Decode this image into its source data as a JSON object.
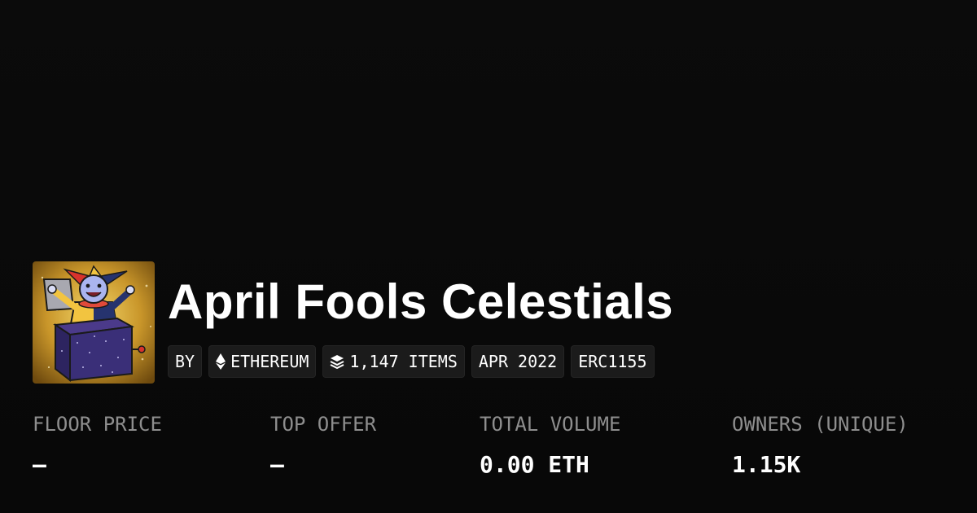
{
  "collection": {
    "title": "April Fools Celestials",
    "image": "jack-in-the-box-jester-avatar"
  },
  "tags": {
    "by": "BY",
    "chain": "ETHEREUM",
    "chain_icon": "ethereum-icon",
    "items": "1,147 ITEMS",
    "items_icon": "layers-icon",
    "date": "APR 2022",
    "standard": "ERC1155"
  },
  "stats": {
    "floor_price": {
      "label": "FLOOR PRICE",
      "value": "–"
    },
    "top_offer": {
      "label": "TOP OFFER",
      "value": "–"
    },
    "total_volume": {
      "label": "TOTAL VOLUME",
      "value": "0.00 ETH"
    },
    "owners": {
      "label": "OWNERS (UNIQUE)",
      "value": "1.15K"
    }
  },
  "colors": {
    "background": "#0a0a0a",
    "tag_background": "#1b1b1b",
    "label_gray": "#8e8e8e",
    "text": "#ffffff"
  }
}
